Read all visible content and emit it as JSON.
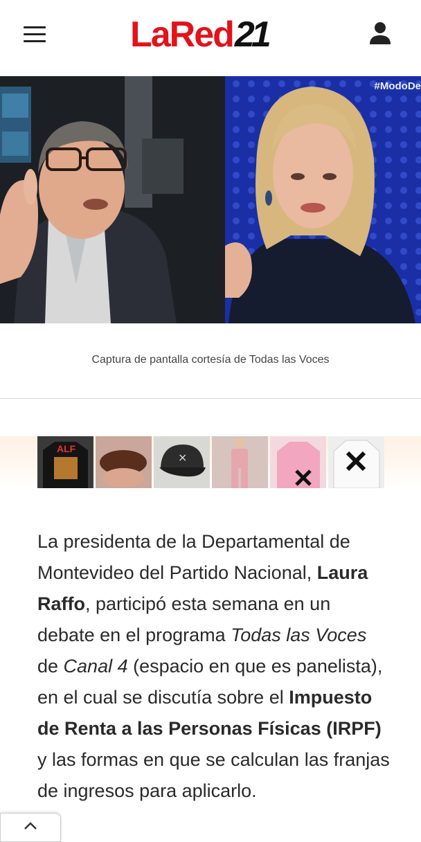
{
  "header": {
    "logo_text_red": "LaRed",
    "logo_text_dark": "21",
    "menu_icon": "hamburger-menu-icon",
    "account_icon": "user-account-icon"
  },
  "hero": {
    "overlay_hashtag": "#ModoDe",
    "caption": "Captura de pantalla cortesía de Todas las Voces"
  },
  "ads": [
    {
      "label": "ALF"
    },
    {
      "label": ""
    },
    {
      "label": ""
    },
    {
      "label": ""
    },
    {
      "label": ""
    },
    {
      "label": ""
    }
  ],
  "article": {
    "t1": "La presidenta de la Departamental de Montevideo del Partido Nacional, ",
    "b1": "Laura Raffo",
    "t2": ", participó esta semana en un debate en el programa ",
    "i1": "Todas las Voces",
    "t3": " de ",
    "i2": "Canal 4",
    "t4": " (espacio en que es panelista), en el cual se discutía sobre el ",
    "b2": "Impuesto de Renta a las Personas Físicas (IRPF)",
    "t5": " y las formas en que se calculan las franjas de ingresos para aplicarlo."
  },
  "scroll_top_icon": "chevron-up-icon",
  "colors": {
    "brand_red": "#e3121b",
    "text": "#2a2a2a"
  }
}
